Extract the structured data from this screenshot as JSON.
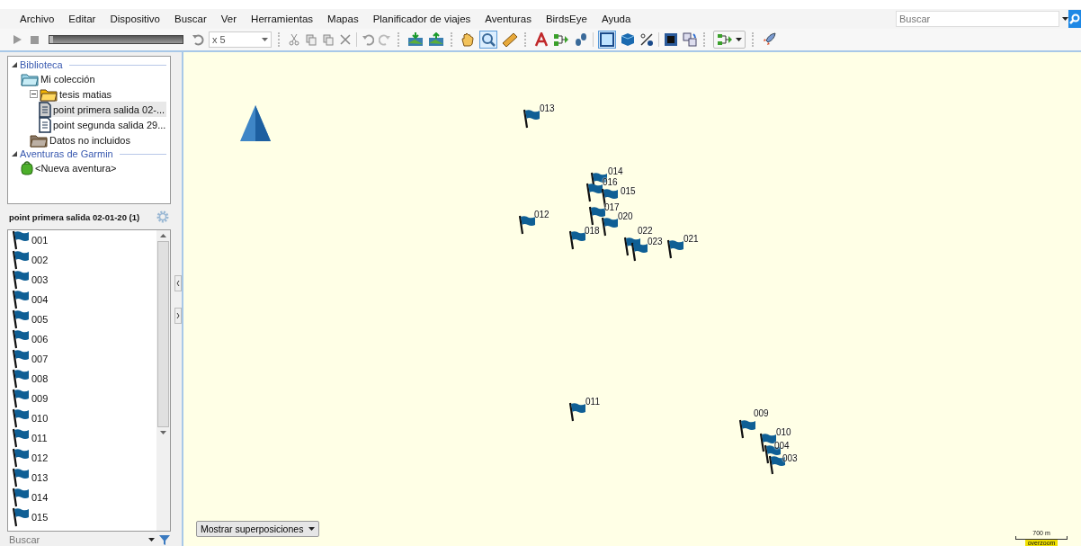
{
  "menu": [
    "Archivo",
    "Editar",
    "Dispositivo",
    "Buscar",
    "Ver",
    "Herramientas",
    "Mapas",
    "Planificador de viajes",
    "Aventuras",
    "BirdsEye",
    "Ayuda"
  ],
  "search": {
    "placeholder": "Buscar"
  },
  "toolbar": {
    "playback": {
      "level": 0.03
    },
    "speed": "x 5"
  },
  "library": [
    {
      "label": "Biblioteca",
      "children": [
        {
          "label": "Mi colección",
          "kind": "collection",
          "selected": false,
          "children": [
            {
              "label": "tesis matias",
              "kind": "folder",
              "expanded": true,
              "selected": false,
              "children": [
                {
                  "label": "point primera salida 02-...",
                  "kind": "file",
                  "selected": true
                },
                {
                  "label": "point segunda salida 29...",
                  "kind": "file",
                  "selected": false
                }
              ]
            },
            {
              "label": "Datos no incluidos",
              "kind": "closed-folder",
              "selected": false
            }
          ]
        }
      ]
    },
    {
      "label": "Aventuras de Garmin",
      "children": [
        {
          "label": "<Nueva aventura>",
          "kind": "adventure",
          "selected": false
        }
      ]
    }
  ],
  "list_title": "point primera salida 02-01-20 (1)",
  "waypoints": [
    "001",
    "002",
    "003",
    "004",
    "005",
    "006",
    "007",
    "008",
    "009",
    "010",
    "011",
    "012",
    "013",
    "014",
    "015"
  ],
  "list_search": {
    "placeholder": "Buscar"
  },
  "map": {
    "overlay_button": "Mostrar superposiciones",
    "scale": "700 m",
    "badge": "overzoom",
    "markers": [
      {
        "label": "013"
      },
      {
        "label": "014"
      },
      {
        "label": "016"
      },
      {
        "label": "015"
      },
      {
        "label": "017"
      },
      {
        "label": "012"
      },
      {
        "label": "020"
      },
      {
        "label": "018"
      },
      {
        "label": "022"
      },
      {
        "label": "023"
      },
      {
        "label": "021"
      },
      {
        "label": "011"
      },
      {
        "label": "009"
      },
      {
        "label": "010"
      },
      {
        "label": "004"
      },
      {
        "label": "003"
      }
    ]
  }
}
